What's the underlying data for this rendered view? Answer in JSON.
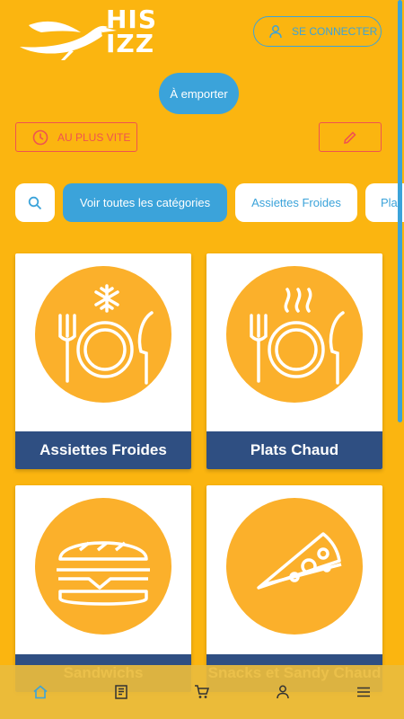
{
  "brand": {
    "logo_text_line1": "HIS",
    "logo_text_line2": "IZZ"
  },
  "header": {
    "login_label": "SE CONNECTER"
  },
  "order_mode": {
    "label": "À emporter"
  },
  "timing": {
    "label": "AU PLUS VITE"
  },
  "categories": {
    "chips": [
      "Voir toutes les catégories",
      "Assiettes Froides",
      "Pla"
    ]
  },
  "products": [
    {
      "label": "Assiettes Froides",
      "icon": "cold-plate-icon"
    },
    {
      "label": "Plats Chaud",
      "icon": "hot-plate-icon"
    },
    {
      "label": "Sandwichs",
      "icon": "sandwich-icon"
    },
    {
      "label": "Snacks et Sandy Chaud",
      "icon": "pizza-slice-icon"
    }
  ],
  "bottom_nav": [
    "home-icon",
    "menu-book-icon",
    "cart-icon",
    "account-icon",
    "hamburger-icon"
  ],
  "colors": {
    "background": "#FBB510",
    "accent_blue": "#3BA3DA",
    "accent_red": "#EF5350",
    "card_label": "#2F4F82",
    "circle": "#FBB02B"
  }
}
